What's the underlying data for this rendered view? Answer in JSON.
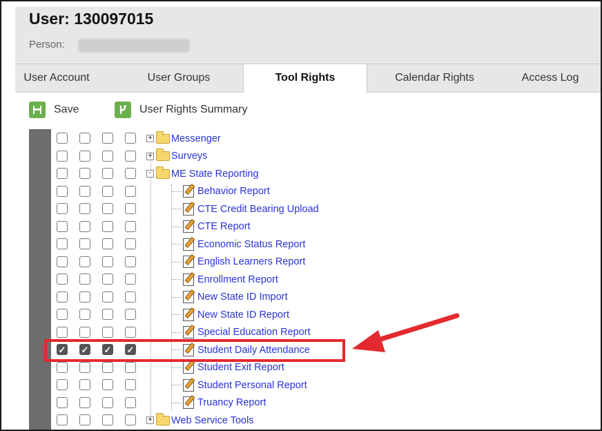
{
  "header": {
    "title": "User: 130097015",
    "person_label": "Person:"
  },
  "tabs": [
    {
      "label": "User Account",
      "active": false
    },
    {
      "label": "User Groups",
      "active": false
    },
    {
      "label": "Tool Rights",
      "active": true
    },
    {
      "label": "Calendar Rights",
      "active": false
    },
    {
      "label": "Access Log",
      "active": false
    }
  ],
  "toolbar": {
    "save_label": "Save",
    "summary_label": "User Rights Summary"
  },
  "tree": [
    {
      "label": "Messenger",
      "type": "folder",
      "expander": "+",
      "checked": false
    },
    {
      "label": "Surveys",
      "type": "folder",
      "expander": "+",
      "checked": false
    },
    {
      "label": "ME State Reporting",
      "type": "folder",
      "expander": "-",
      "checked": false
    },
    {
      "label": "Behavior Report",
      "type": "tool",
      "checked": false
    },
    {
      "label": "CTE Credit Bearing Upload",
      "type": "tool",
      "checked": false
    },
    {
      "label": "CTE Report",
      "type": "tool",
      "checked": false
    },
    {
      "label": "Economic Status Report",
      "type": "tool",
      "checked": false
    },
    {
      "label": "English Learners Report",
      "type": "tool",
      "checked": false
    },
    {
      "label": "Enrollment Report",
      "type": "tool",
      "checked": false
    },
    {
      "label": "New State ID Import",
      "type": "tool",
      "checked": false
    },
    {
      "label": "New State ID Report",
      "type": "tool",
      "checked": false
    },
    {
      "label": "Special Education Report",
      "type": "tool",
      "checked": false
    },
    {
      "label": "Student Daily Attendance",
      "type": "tool",
      "checked": true
    },
    {
      "label": "Student Exit Report",
      "type": "tool",
      "checked": false
    },
    {
      "label": "Student Personal Report",
      "type": "tool",
      "checked": false
    },
    {
      "label": "Truancy Report",
      "type": "tool",
      "checked": false
    },
    {
      "label": "Web Service Tools",
      "type": "folder",
      "expander": "+",
      "checked": false
    }
  ],
  "colors": {
    "link": "#2a32d6",
    "highlight": "#e32a2f",
    "save_green": "#6ab04c"
  }
}
